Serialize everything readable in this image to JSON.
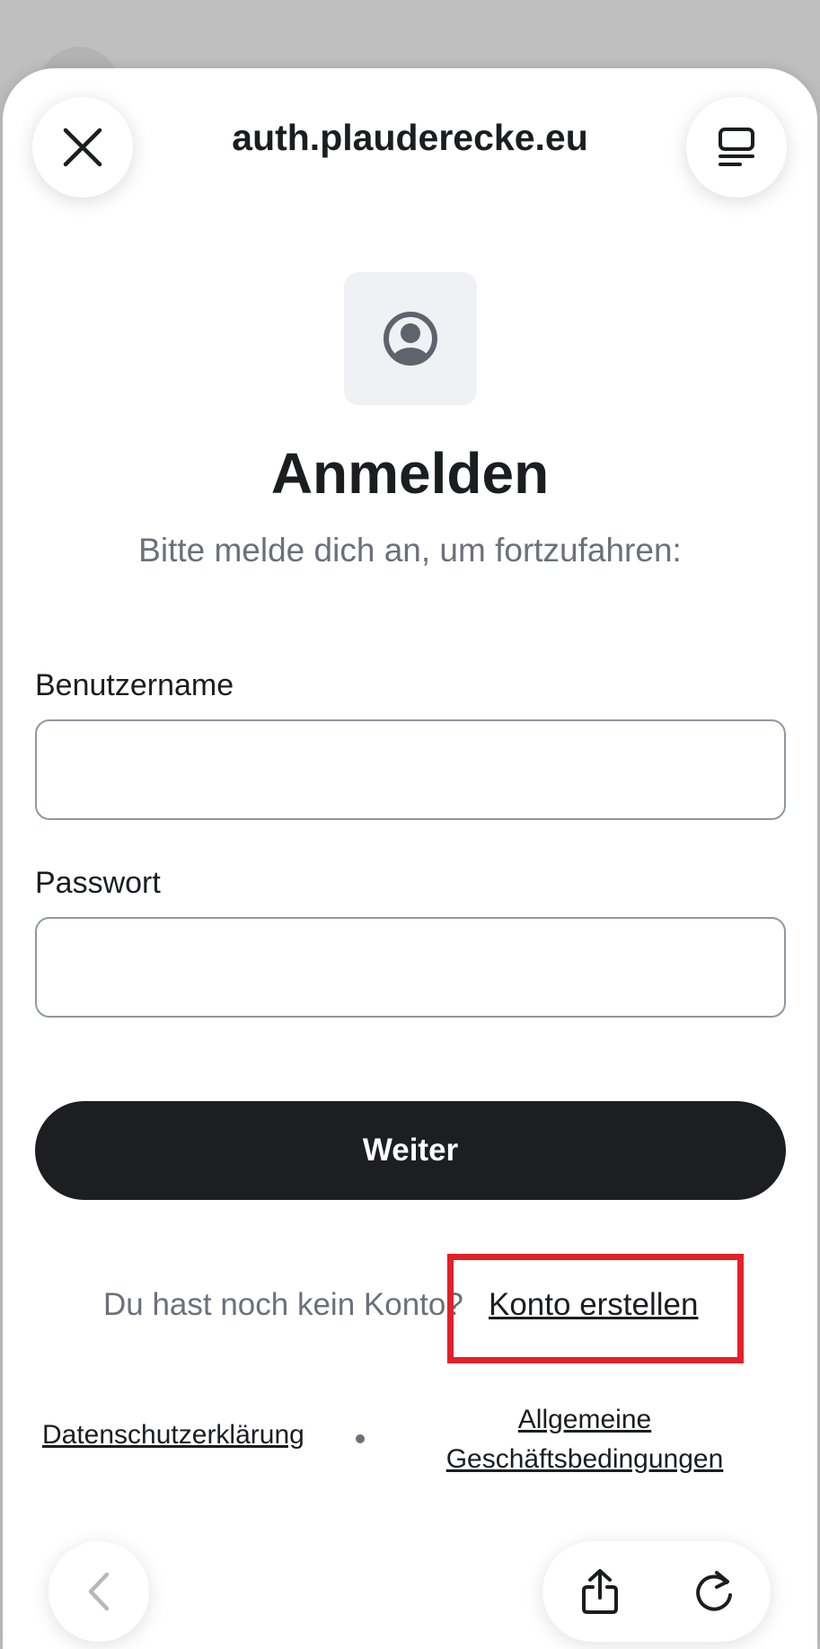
{
  "browser": {
    "url": "auth.plauderecke.eu",
    "close_icon": "close-icon",
    "reader_icon": "reader-mode-icon"
  },
  "login": {
    "logo_icon": "user-avatar-icon",
    "title": "Anmelden",
    "subtitle": "Bitte melde dich an, um fortzufahren:",
    "username_label": "Benutzername",
    "username_value": "",
    "password_label": "Passwort",
    "password_value": "",
    "continue_label": "Weiter",
    "no_account_text": "Du hast noch kein Konto?",
    "create_account_link": "Konto erstellen",
    "privacy_link": "Datenschutzerklärung",
    "terms_link": "Allgemeine Geschäftsbedingungen"
  },
  "toolbar": {
    "back_icon": "chevron-left-icon",
    "share_icon": "share-icon",
    "reload_icon": "reload-icon"
  },
  "colors": {
    "highlight": "#e3202a",
    "primary_button": "#1d1e21",
    "muted_text": "#6b7079"
  }
}
